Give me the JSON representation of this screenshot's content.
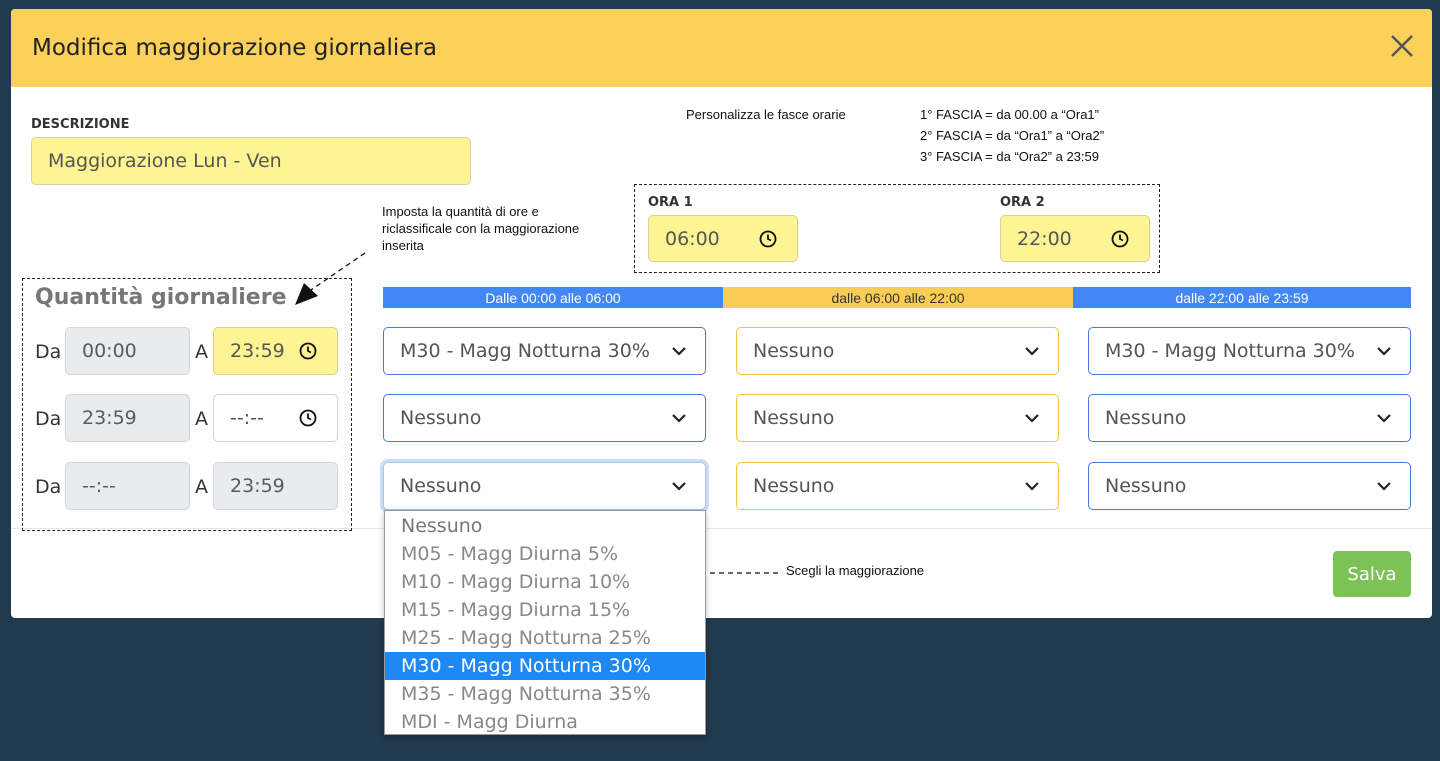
{
  "dialog": {
    "title": "Modifica maggiorazione giornaliera",
    "save_label": "Salva"
  },
  "descrizione": {
    "label": "DESCRIZIONE",
    "value": "Maggiorazione Lun - Ven"
  },
  "notes": {
    "fasce_title": "Personalizza le fasce orarie",
    "fascia_1": "1° FASCIA = da 00.00 a “Ora1”",
    "fascia_2": "2° FASCIA = da “Ora1” a “Ora2”",
    "fascia_3": "3° FASCIA = da “Ora2” a 23:59",
    "quantita_line1": "Imposta la quantità di ore e",
    "quantita_line2": "riclassificale con la maggiorazione",
    "quantita_line3": "inserita",
    "scegli": "Scegli la maggiorazione"
  },
  "ore": {
    "ora1_label": "ORA 1",
    "ora1_value": "06:00",
    "ora2_label": "ORA 2",
    "ora2_value": "22:00"
  },
  "quantita": {
    "title": "Quantità giornaliere",
    "da_label": "Da",
    "a_label": "A",
    "rows": [
      {
        "da": "00:00",
        "a": "23:59"
      },
      {
        "da": "23:59",
        "a": "--:--"
      },
      {
        "da": "--:--",
        "a": "23:59"
      }
    ]
  },
  "bands": [
    "Dalle 00:00 alle 06:00",
    "dalle 06:00 alle 22:00",
    "dalle 22:00 alle 23:59"
  ],
  "selects": [
    [
      "M30 - Magg Notturna 30%",
      "Nessuno",
      "M30 - Magg Notturna 30%"
    ],
    [
      "Nessuno",
      "Nessuno",
      "Nessuno"
    ],
    [
      "Nessuno",
      "Nessuno",
      "Nessuno"
    ]
  ],
  "dropdown_options": [
    "Nessuno",
    "M05 - Magg Diurna 5%",
    "M10 - Magg Diurna 10%",
    "M15 - Magg Diurna 15%",
    "M25 - Magg Notturna 25%",
    "M30 - Magg Notturna 30%",
    "M35 - Magg Notturna 35%",
    "MDI - Magg Diurna"
  ],
  "colors": {
    "header": "#fcd15b",
    "band_blue": "#4287f5",
    "band_yellow": "#f9cd55",
    "highlight": "#1e88f5",
    "save": "#7cc257"
  }
}
